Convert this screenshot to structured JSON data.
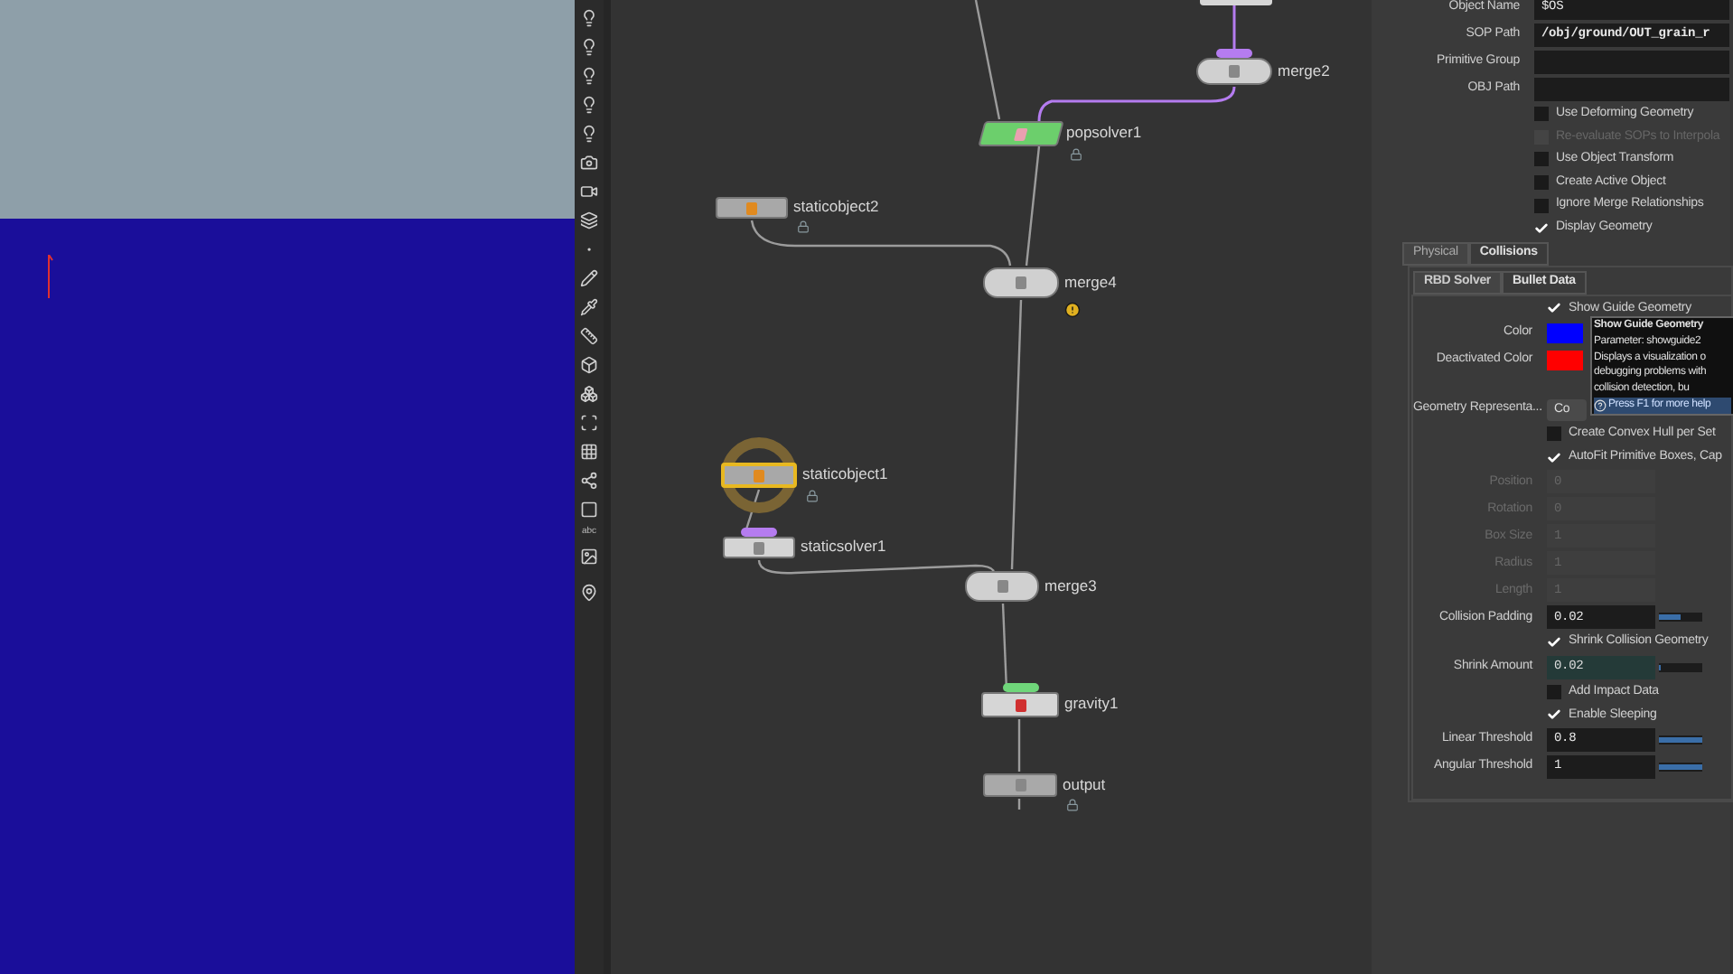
{
  "toolbar": {
    "text_tool": "abc"
  },
  "network": {
    "nodes": [
      {
        "kind": "merge",
        "label": "merge2",
        "color": "#b57cf0",
        "selected": false,
        "locked": false,
        "warning": false
      },
      {
        "kind": "popsolver",
        "label": "popsolver1",
        "selected": false,
        "locked": true,
        "warning": false
      },
      {
        "kind": "object",
        "label": "staticobject2",
        "selected": false,
        "locked": true,
        "warning": false
      },
      {
        "kind": "merge",
        "label": "merge4",
        "selected": false,
        "locked": false,
        "warning": true
      },
      {
        "kind": "object",
        "label": "staticobject1",
        "selected": true,
        "locked": true,
        "warning": false
      },
      {
        "kind": "solver",
        "label": "staticsolver1",
        "color": "#b57cf0",
        "selected": false,
        "locked": false,
        "warning": false
      },
      {
        "kind": "merge",
        "label": "merge3",
        "selected": false,
        "locked": false,
        "warning": false
      },
      {
        "kind": "gravity",
        "label": "gravity1",
        "color": "#6fd67a",
        "selected": false,
        "locked": false,
        "warning": false
      },
      {
        "kind": "output",
        "label": "output",
        "selected": false,
        "locked": true,
        "warning": false
      }
    ]
  },
  "parameters": {
    "rows": [
      {
        "kind": "field",
        "label": "Object Name",
        "value": "$OS",
        "disabled": false
      },
      {
        "kind": "field",
        "label": "SOP Path",
        "value": "/obj/ground/OUT_grain_r",
        "disabled": false
      },
      {
        "kind": "field",
        "label": "Primitive Group",
        "disabled": false
      },
      {
        "kind": "field",
        "label": "OBJ Path",
        "disabled": false
      },
      {
        "kind": "check",
        "label": "Use Deforming Geometry",
        "checked": false,
        "disabled": false
      },
      {
        "kind": "check",
        "label": "Re-evaluate SOPs to Interpola",
        "checked": false,
        "disabled": true
      },
      {
        "kind": "check",
        "label": "Use Object Transform",
        "checked": false,
        "disabled": false
      },
      {
        "kind": "check",
        "label": "Create Active Object",
        "checked": false,
        "disabled": false
      },
      {
        "kind": "check",
        "label": "Ignore Merge Relationships",
        "checked": false,
        "disabled": false
      },
      {
        "kind": "check",
        "label": "Display Geometry",
        "checked": true,
        "disabled": false
      }
    ],
    "tabs": [
      {
        "label": "Physical",
        "selected": false
      },
      {
        "label": "Collisions",
        "selected": true
      }
    ],
    "subtabs": [
      {
        "label": "RBD Solver",
        "selected": false
      },
      {
        "label": "Bullet Data",
        "selected": true
      }
    ],
    "collision_rows": [
      {
        "kind": "check",
        "label": "Show Guide Geometry",
        "checked": true,
        "disabled": false
      },
      {
        "kind": "color",
        "label": "Color",
        "color": "#0000ff"
      },
      {
        "kind": "color",
        "label": "Deactivated Color",
        "color": "#ff0000"
      },
      {
        "kind": "menu",
        "label": "Geometry Representa...",
        "value": "Co"
      },
      {
        "kind": "check",
        "label": "Create Convex Hull per Set",
        "checked": false,
        "disabled": false
      },
      {
        "kind": "check",
        "label": "AutoFit Primitive Boxes, Cap",
        "checked": true,
        "disabled": false
      },
      {
        "kind": "field",
        "label": "Position",
        "value": "0",
        "disabled": true
      },
      {
        "kind": "field",
        "label": "Rotation",
        "value": "0",
        "disabled": true
      },
      {
        "kind": "field",
        "label": "Box Size",
        "value": "1",
        "disabled": true
      },
      {
        "kind": "field",
        "label": "Radius",
        "value": "1",
        "disabled": true
      },
      {
        "kind": "field",
        "label": "Length",
        "value": "1",
        "disabled": true
      },
      {
        "kind": "field",
        "label": "Collision Padding",
        "value": "0.02",
        "disabled": false,
        "level": 0.5
      },
      {
        "kind": "check",
        "label": "Shrink Collision Geometry",
        "checked": true,
        "disabled": false
      },
      {
        "kind": "field",
        "label": "Shrink Amount",
        "value": "0.02",
        "disabled": false,
        "level": 0.05
      },
      {
        "kind": "check",
        "label": "Add Impact Data",
        "checked": false,
        "disabled": false
      },
      {
        "kind": "check",
        "label": "Enable Sleeping",
        "checked": true,
        "disabled": false
      },
      {
        "kind": "field",
        "label": "Linear Threshold",
        "value": "0.8",
        "disabled": false,
        "level": 1
      },
      {
        "kind": "field",
        "label": "Angular Threshold",
        "value": "1",
        "disabled": false,
        "level": 1
      }
    ],
    "tooltip": {
      "title": "Show Guide Geometry",
      "lines": [
        "Parameter: showguide2",
        "Displays a visualization o",
        "debugging problems with",
        "collision detection, bu"
      ],
      "help": "Press F1 for more help"
    }
  }
}
